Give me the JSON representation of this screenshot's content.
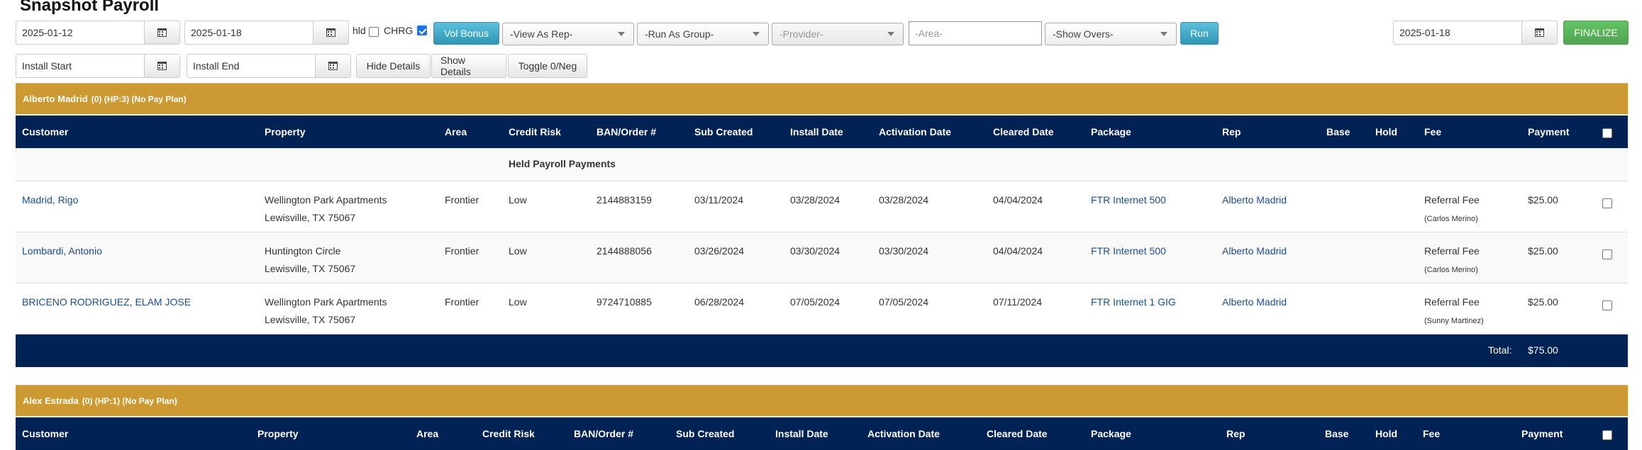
{
  "page": {
    "title": "Snapshot Payroll"
  },
  "toolbar": {
    "start_date": "2025-01-12",
    "end_date": "2025-01-18",
    "hld_label": "hld",
    "hld_checked": false,
    "chrg_label": "CHRG",
    "chrg_checked": true,
    "vol_bonus_label": "Vol Bonus",
    "view_as_rep": "-View As Rep-",
    "run_as_group": "-Run As Group-",
    "provider": "-Provider-",
    "area_placeholder": "-Area-",
    "show_overs": "-Show Overs-",
    "run_label": "Run",
    "finalize_date": "2025-01-18",
    "finalize_label": "FINALIZE"
  },
  "toolbar2": {
    "install_start_placeholder": "Install Start",
    "install_end_placeholder": "Install End",
    "hide_details_label": "Hide Details",
    "show_details_label": "Show Details",
    "toggle_label": "Toggle 0/Neg"
  },
  "columns": [
    "Customer",
    "Property",
    "Area",
    "Credit Risk",
    "BAN/Order #",
    "Sub Created",
    "Install Date",
    "Activation Date",
    "Cleared Date",
    "Package",
    "Rep",
    "Base",
    "Hold",
    "Fee",
    "Payment"
  ],
  "sections": [
    {
      "rep_name": "Alberto Madrid",
      "rep_meta": "(0) (HP:3) (No Pay Plan)",
      "group_title": "Held Payroll Payments",
      "rows": [
        {
          "customer": "Madrid, Rigo",
          "property_line1": "Wellington Park Apartments",
          "property_line2": "Lewisville, TX 75067",
          "area": "Frontier",
          "credit_risk": "Low",
          "ban": "2144883159",
          "sub_created": "03/11/2024",
          "install_date": "03/28/2024",
          "activation_date": "03/28/2024",
          "cleared_date": "04/04/2024",
          "package": "FTR Internet 500",
          "rep": "Alberto Madrid",
          "base": "",
          "hold": "",
          "fee": "Referral Fee",
          "fee_note": "(Carlos Merino)",
          "payment": "$25.00"
        },
        {
          "customer": "Lombardi, Antonio",
          "property_line1": "Huntington Circle",
          "property_line2": "Lewisville, TX 75067",
          "area": "Frontier",
          "credit_risk": "Low",
          "ban": "2144888056",
          "sub_created": "03/26/2024",
          "install_date": "03/30/2024",
          "activation_date": "03/30/2024",
          "cleared_date": "04/04/2024",
          "package": "FTR Internet 500",
          "rep": "Alberto Madrid",
          "base": "",
          "hold": "",
          "fee": "Referral Fee",
          "fee_note": "(Carlos Merino)",
          "payment": "$25.00"
        },
        {
          "customer": "BRICENO RODRIGUEZ, ELAM JOSE",
          "property_line1": "Wellington Park Apartments",
          "property_line2": "Lewisville, TX 75067",
          "area": "Frontier",
          "credit_risk": "Low",
          "ban": "9724710885",
          "sub_created": "06/28/2024",
          "install_date": "07/05/2024",
          "activation_date": "07/05/2024",
          "cleared_date": "07/11/2024",
          "package": "FTR Internet 1 GIG",
          "rep": "Alberto Madrid",
          "base": "",
          "hold": "",
          "fee": "Referral Fee",
          "fee_note": "(Sunny Martinez)",
          "payment": "$25.00"
        }
      ],
      "total_label": "Total:",
      "total_value": "$75.00"
    },
    {
      "rep_name": "Alex Estrada",
      "rep_meta": "(0) (HP:1) (No Pay Plan)"
    }
  ],
  "colors": {
    "rep_header": "#cc9933",
    "table_header": "#002255",
    "link": "#1f4e8c",
    "finalize": "#51a351",
    "run": "#2f96b4"
  }
}
